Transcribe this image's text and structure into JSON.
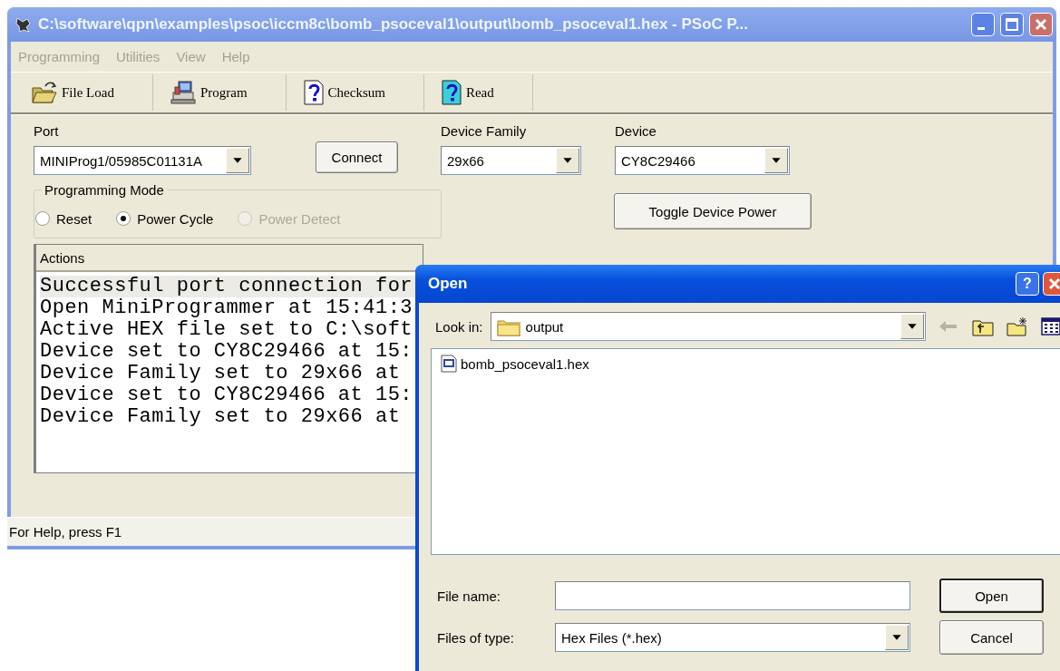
{
  "main_window": {
    "title": "C:\\software\\qpn\\examples\\psoc\\iccm8c\\bomb_psoceval1\\output\\bomb_psoceval1.hex - PSoC P...",
    "menu": [
      {
        "label": "Programming",
        "disabled": true
      },
      {
        "label": "Utilities",
        "disabled": true
      },
      {
        "label": "View",
        "disabled": true
      },
      {
        "label": "Help",
        "disabled": true
      }
    ],
    "toolbar": [
      {
        "label": "File Load",
        "kind": "folder"
      },
      {
        "label": "Program",
        "kind": "computer"
      },
      {
        "label": "Checksum",
        "kind": "query"
      },
      {
        "label": "Read",
        "kind": "query-cyan"
      }
    ],
    "port": {
      "label": "Port",
      "value": "MINIProg1/05985C01131A"
    },
    "connect_button": "Connect",
    "device_family": {
      "label": "Device Family",
      "value": "29x66"
    },
    "device": {
      "label": "Device",
      "value": "CY8C29466"
    },
    "programming_mode": {
      "label": "Programming Mode",
      "options": [
        {
          "label": "Reset",
          "selected": false,
          "disabled": false
        },
        {
          "label": "Power Cycle",
          "selected": true,
          "disabled": false
        },
        {
          "label": "Power Detect",
          "selected": false,
          "disabled": true
        }
      ]
    },
    "toggle_power_button": "Toggle Device Power",
    "actions": {
      "header": "Actions",
      "lines": [
        {
          "text": "Successful port connection for",
          "selected": true
        },
        {
          "text": "Open MiniProgrammer at 15:41:3",
          "selected": false
        },
        {
          "text": "Active HEX file set to C:\\soft",
          "selected": false
        },
        {
          "text": "Device set to CY8C29466 at 15:",
          "selected": false
        },
        {
          "text": "Device Family set to 29x66 at",
          "selected": false
        },
        {
          "text": "Device set to CY8C29466 at 15:",
          "selected": false
        },
        {
          "text": "Device Family set to 29x66 at",
          "selected": false
        }
      ]
    },
    "status_bar": "For Help, press F1"
  },
  "open_dialog": {
    "title": "Open",
    "help_button": "?",
    "look_in": {
      "label": "Look in:",
      "value": "output"
    },
    "files": [
      {
        "name": "bomb_psoceval1.hex",
        "selected": false
      }
    ],
    "file_name": {
      "label": "File name:"
    },
    "files_of_type": {
      "label": "Files of type:",
      "value": "Hex Files (*.hex)"
    },
    "buttons": [
      "Open",
      "Cancel"
    ]
  }
}
